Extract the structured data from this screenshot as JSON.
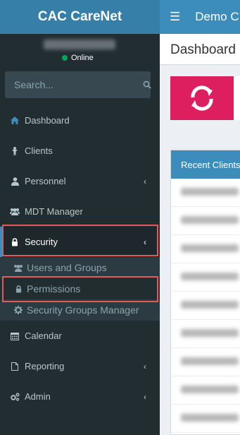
{
  "brand": {
    "title": "CAC CareNet"
  },
  "user": {
    "status": "Online"
  },
  "search": {
    "placeholder": "Search..."
  },
  "menu": [
    {
      "label": "Dashboard",
      "icon": "home-icon"
    },
    {
      "label": "Clients",
      "icon": "child-icon"
    },
    {
      "label": "Personnel",
      "icon": "user-icon"
    },
    {
      "label": "MDT Manager",
      "icon": "users-icon"
    },
    {
      "label": "Security",
      "icon": "lock-icon"
    },
    {
      "label": "Calendar",
      "icon": "calendar-icon"
    },
    {
      "label": "Reporting",
      "icon": "file-icon"
    },
    {
      "label": "Admin",
      "icon": "cogs-icon"
    }
  ],
  "security_sub": [
    {
      "label": "Users and Groups",
      "icon": "users-icon"
    },
    {
      "label": "Permissions",
      "icon": "lock-icon"
    },
    {
      "label": "Security Groups Manager",
      "icon": "gear-icon"
    }
  ],
  "topbar": {
    "title": "Demo C"
  },
  "content": {
    "title": "Dashboard",
    "recent_clients": "Recent Clients"
  },
  "colors": {
    "sidebar": "#222d32",
    "brand": "#367fa9",
    "accent": "#3c8dbc",
    "tile": "#dd1f5f",
    "highlight": "#e05a5a"
  }
}
